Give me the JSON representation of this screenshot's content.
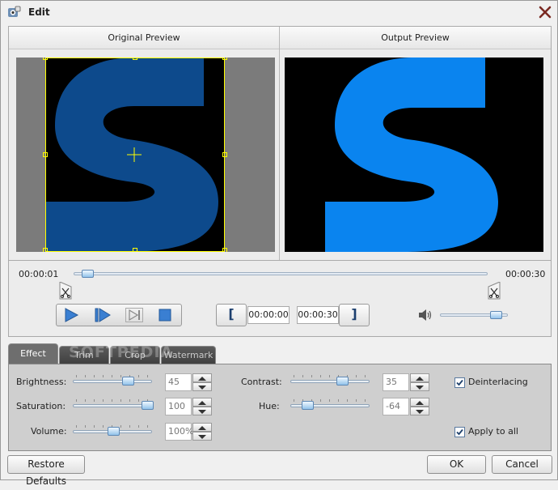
{
  "window": {
    "title": "Edit"
  },
  "preview": {
    "original_label": "Original Preview",
    "output_label": "Output Preview",
    "original_color": "#0d4a8c",
    "output_color": "#0a84ef"
  },
  "playback": {
    "current_time": "00:00:01",
    "end_time": "00:00:30",
    "progress": 0.02,
    "clip_start": "00:00:00",
    "clip_end": "00:00:30",
    "volume_level": 0.9
  },
  "tabs": [
    {
      "label": "Effect",
      "active": true
    },
    {
      "label": "Trim",
      "active": false
    },
    {
      "label": "Crop",
      "active": false
    },
    {
      "label": "Watermark",
      "active": false
    }
  ],
  "effect": {
    "brightness": {
      "label": "Brightness:",
      "value": "45",
      "level": 0.72
    },
    "saturation": {
      "label": "Saturation:",
      "value": "100",
      "level": 1.0
    },
    "volume": {
      "label": "Volume:",
      "value": "100%",
      "level": 0.5
    },
    "contrast": {
      "label": "Contrast:",
      "value": "35",
      "level": 0.67
    },
    "hue": {
      "label": "Hue:",
      "value": "-64",
      "level": 0.16
    },
    "deinterlacing": {
      "label": "Deinterlacing",
      "checked": true
    },
    "apply_to_all": {
      "label": "Apply to all",
      "checked": true
    }
  },
  "buttons": {
    "restore_defaults": "Restore Defaults",
    "ok": "OK",
    "cancel": "Cancel"
  },
  "watermark_overlay": "SOFTPEDIA",
  "colors": {
    "accent": "#0a84ef",
    "panel": "#cfcfcf"
  }
}
